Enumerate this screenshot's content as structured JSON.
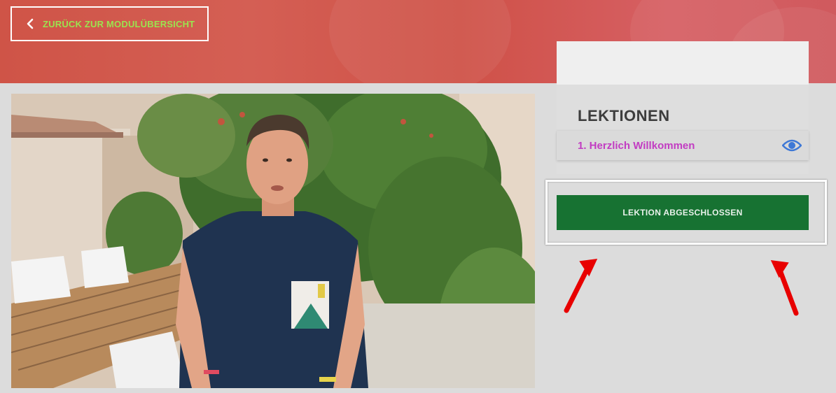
{
  "header": {
    "back_label": "ZURÜCK ZUR MODULÜBERSICHT",
    "back_icon": "chevron-left-icon"
  },
  "video": {
    "content": "video-frame"
  },
  "sidebar": {
    "lessons_title": "LEKTIONEN",
    "lessons": [
      {
        "label": "1. Herzlich Willkommen",
        "icon": "eye-icon"
      }
    ],
    "complete_label": "LEKTION ABGESCHLOSSEN"
  },
  "colors": {
    "header_red": "#cf5447",
    "back_text": "#9be34f",
    "lesson_link": "#c23cc2",
    "complete_green": "#177232",
    "eye_blue": "#3e78d6",
    "annotation_arrow": "#e80000"
  }
}
